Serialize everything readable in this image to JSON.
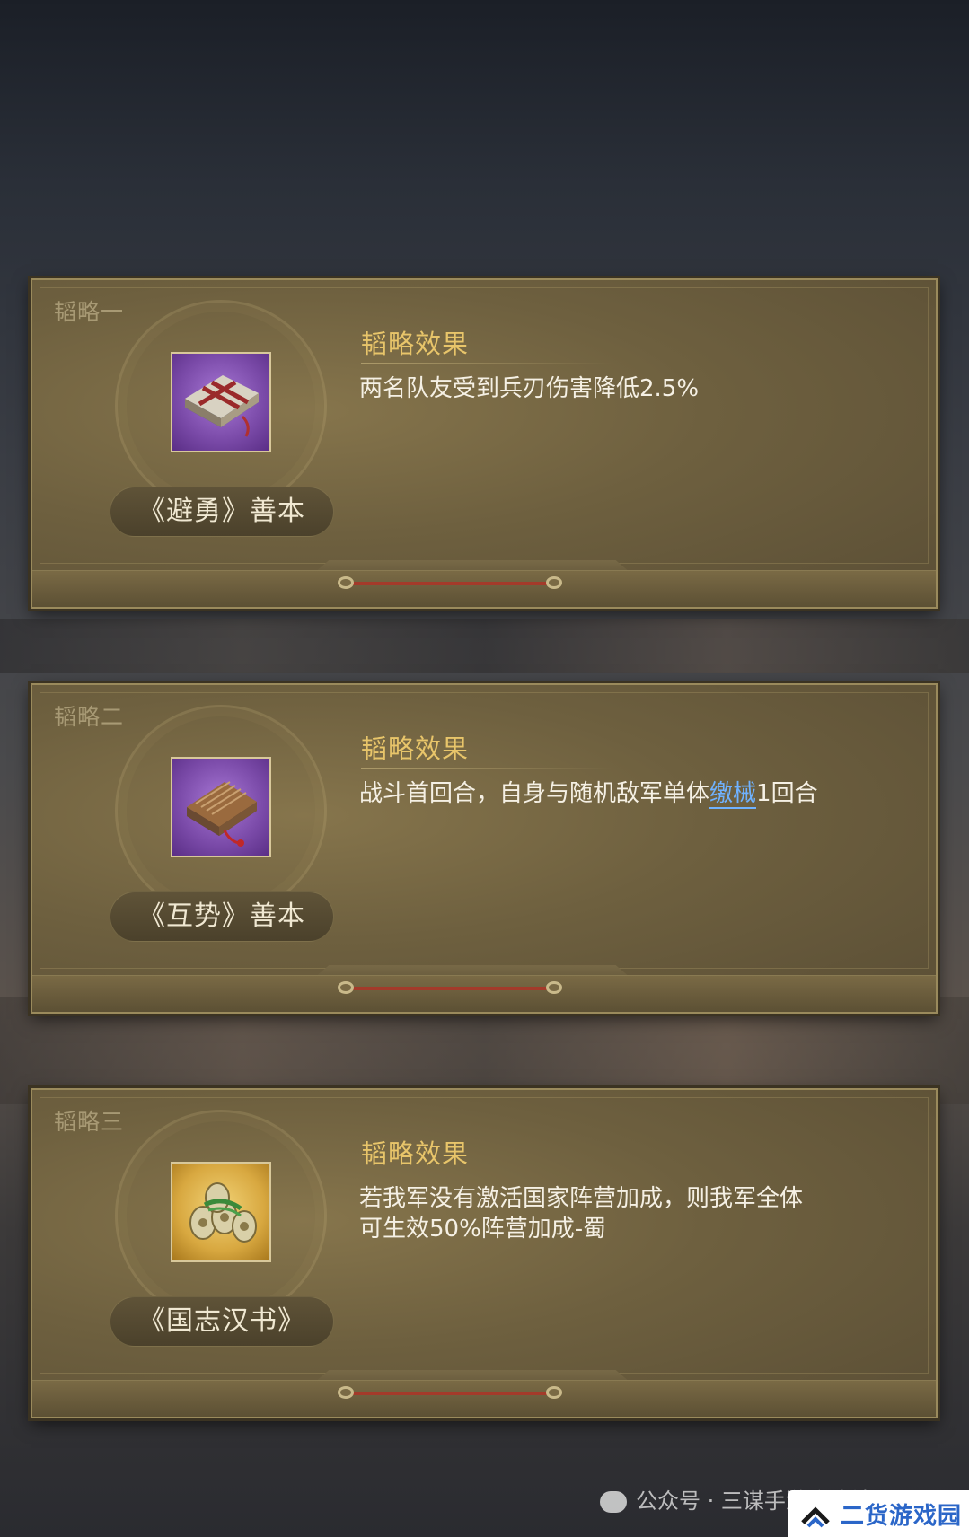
{
  "panels": [
    {
      "label": "韬略一",
      "item_name": "《避勇》善本",
      "effect_title": "韬略效果",
      "effect_text": "两名队友受到兵刃伤害降低2.5%"
    },
    {
      "label": "韬略二",
      "item_name": "《互势》善本",
      "effect_title": "韬略效果",
      "effect_text_before": "战斗首回合，自身与随机敌军单体",
      "effect_text_highlight": "缴械",
      "effect_text_after": "1回合"
    },
    {
      "label": "韬略三",
      "item_name": "《国志汉书》",
      "effect_title": "韬略效果",
      "effect_text_line1": "若我军没有激活国家阵营加成，则我军全体",
      "effect_text_line2": "可生效50%阵营加成-蜀"
    }
  ],
  "watermark": {
    "text": "公众号 · 三谋手游攻略社",
    "icon": "wechat-icon"
  },
  "logo": {
    "text": "二货游戏园",
    "icon": "chevron-up-icon"
  },
  "colors": {
    "effect_title": "#e8c56a",
    "highlight": "#6fb2ff",
    "cord": "#a33a2a"
  }
}
